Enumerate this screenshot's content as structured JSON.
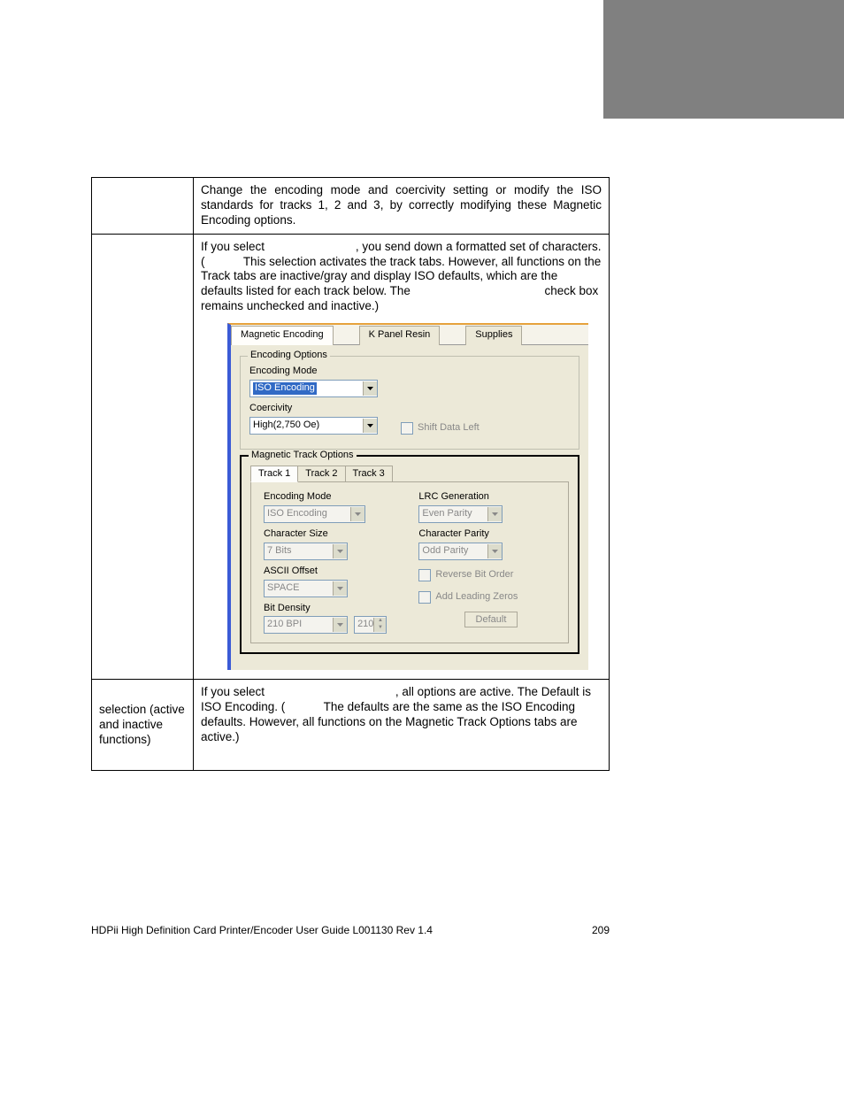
{
  "sidebar_gray": true,
  "table": {
    "row1": {
      "left": "",
      "right": "Change the encoding mode and coercivity setting or modify the ISO standards for tracks 1, 2 and 3, by correctly modifying these Magnetic Encoding options."
    },
    "row2": {
      "left": "",
      "right_segments": {
        "a": "If you select",
        "b": ", you send down a formatted set of characters. (",
        "c": "This selection activates the track tabs. However, all functions on the Track tabs are inactive/gray and display ISO defaults, which are the defaults listed for each track below. The",
        "d": "check box remains unchecked and inactive.)"
      }
    },
    "row3": {
      "left": "selection (active and inactive functions)",
      "right_segments": {
        "a": "If you select",
        "b": ", all options are active. The Default is ISO Encoding. (",
        "c": "The defaults are the same as the ISO Encoding defaults. However, all functions on the Magnetic Track Options tabs are active.)"
      }
    }
  },
  "dialog": {
    "tabs": {
      "magnetic": "Magnetic Encoding",
      "kpanel": "K Panel Resin",
      "supplies": "Supplies"
    },
    "encoding_options": {
      "legend": "Encoding Options",
      "encoding_mode_label": "Encoding Mode",
      "encoding_mode_value": "ISO Encoding",
      "coercivity_label": "Coercivity",
      "coercivity_value": "High(2,750 Oe)",
      "shift_data_left": "Shift Data Left"
    },
    "magnetic_track": {
      "legend": "Magnetic Track Options",
      "tabs": {
        "t1": "Track 1",
        "t2": "Track 2",
        "t3": "Track 3"
      },
      "left": {
        "encoding_mode_label": "Encoding Mode",
        "encoding_mode_value": "ISO Encoding",
        "char_size_label": "Character Size",
        "char_size_value": "7 Bits",
        "ascii_offset_label": "ASCII Offset",
        "ascii_offset_value": "SPACE",
        "bit_density_label": "Bit Density",
        "bit_density_value": "210 BPI",
        "bit_density_num": "210"
      },
      "right": {
        "lrc_label": "LRC Generation",
        "lrc_value": "Even Parity",
        "char_parity_label": "Character Parity",
        "char_parity_value": "Odd Parity",
        "reverse_bit": "Reverse Bit Order",
        "add_leading_zeros": "Add Leading Zeros",
        "default_btn": "Default"
      }
    }
  },
  "footer": {
    "left": "HDPii High Definition Card Printer/Encoder User Guide    L001130 Rev 1.4",
    "right": "209"
  }
}
